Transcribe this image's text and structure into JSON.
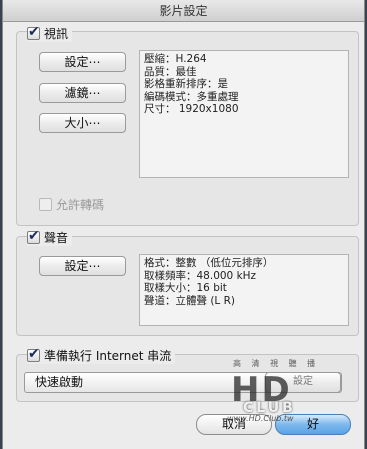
{
  "window": {
    "title": "影片設定"
  },
  "video": {
    "checkbox_label": "視訊",
    "settings_button": "設定⋯",
    "filter_button": "濾鏡⋯",
    "size_button": "大小⋯",
    "info": [
      "壓縮：H.264",
      "品質：最佳",
      "影格重新排序：是",
      "編碼模式：多重處理",
      "尺寸： 1920x1080"
    ],
    "allow_transcode_label": "允許轉碼"
  },
  "audio": {
    "checkbox_label": "聲音",
    "settings_button": "設定⋯",
    "info": [
      "格式：整數 （低位元排序）",
      "取樣頻率：48.000 kHz",
      "取樣大小：16 bit",
      "聲道：立體聲 (L R)"
    ]
  },
  "streaming": {
    "checkbox_label": "準備執行 Internet 串流",
    "option_selected": "快速啟動",
    "settings_button_partial": "設定"
  },
  "footer": {
    "cancel_button": "取消",
    "ok_button": "好"
  },
  "watermark": {
    "top_text": "高 清 視 聽 播",
    "main_text": "HD",
    "club_text": "CLUB",
    "url_text": "www.HD.Club.tw"
  }
}
